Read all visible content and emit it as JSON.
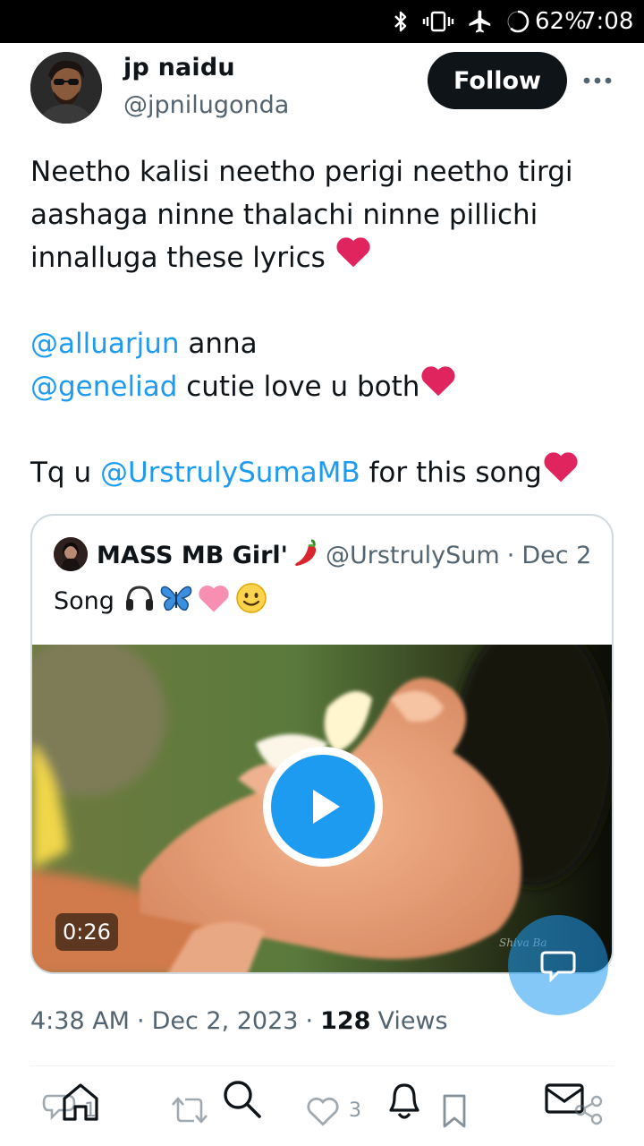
{
  "status_bar": {
    "battery": "62%",
    "time": "7:08",
    "icons": [
      "bluetooth-icon",
      "vibrate-icon",
      "airplane-icon",
      "battery-icon"
    ]
  },
  "tweet": {
    "author_name": "jp naidu",
    "author_handle": "@jpnilugonda",
    "follow_label": "Follow",
    "lines": {
      "l1": "Neetho kalisi neetho perigi neetho tirgi",
      "l2": "aashaga ninne thalachi ninne pillichi",
      "l3": "innalluga these lyrics",
      "l4_mention": "@alluarjun",
      "l4_text": " anna",
      "l5_mention": "@geneliad",
      "l5_text": " cutie love u both",
      "l6_prefix": "Tq u ",
      "l6_mention": "@UrstrulySumaMB",
      "l6_text": " for this song"
    },
    "timestamp_time": "4:38 AM",
    "timestamp_date": "Dec 2, 2023",
    "separator": "·",
    "views_count": "128",
    "views_label": "Views"
  },
  "quote": {
    "author_name": "MASS MB Girl'",
    "author_handle": "@UrstrulySum",
    "separator": "·",
    "date": "Dec 2",
    "text": "Song",
    "video_duration": "0:26",
    "watermark": "Shiva Ba"
  },
  "actions": {
    "reply_count": "1",
    "like_count": "3"
  },
  "colors": {
    "accent": "#1d9bf0",
    "text": "#0f1419",
    "secondary": "#536471",
    "heart": "#e0245e",
    "border": "#cfd9de"
  }
}
